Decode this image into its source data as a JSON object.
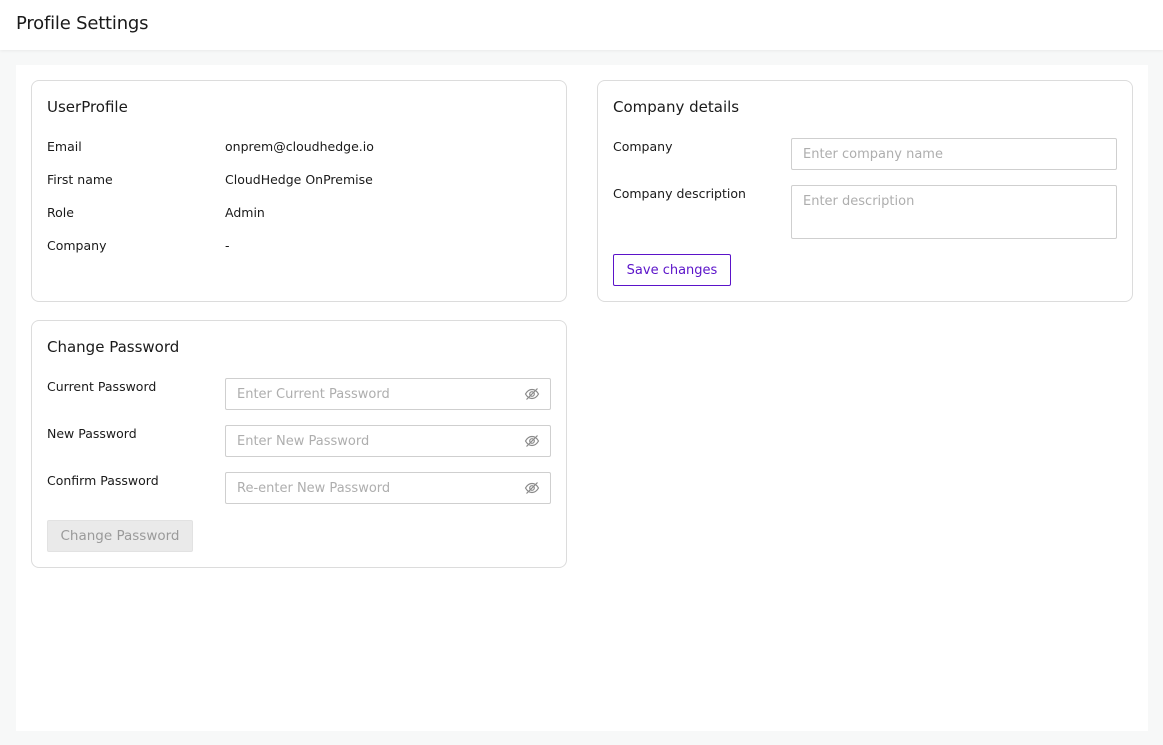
{
  "header": {
    "title": "Profile Settings"
  },
  "user_profile": {
    "title": "UserProfile",
    "fields": [
      {
        "label": "Email",
        "value": "onprem@cloudhedge.io"
      },
      {
        "label": "First name",
        "value": "CloudHedge OnPremise"
      },
      {
        "label": "Role",
        "value": "Admin"
      },
      {
        "label": "Company",
        "value": "-"
      }
    ]
  },
  "company_details": {
    "title": "Company details",
    "company_label": "Company",
    "company_placeholder": "Enter company name",
    "company_value": "",
    "description_label": "Company description",
    "description_placeholder": "Enter description",
    "description_value": "",
    "save_label": "Save changes"
  },
  "change_password": {
    "title": "Change Password",
    "current_label": "Current Password",
    "current_placeholder": "Enter Current Password",
    "new_label": "New Password",
    "new_placeholder": "Enter New Password",
    "confirm_label": "Confirm Password",
    "confirm_placeholder": "Re-enter New Password",
    "submit_label": "Change Password",
    "eye_icon": "eye-off-icon"
  },
  "colors": {
    "accent": "#5b13c9",
    "border": "#dcdcdc",
    "page_bg": "#f7f8f8"
  }
}
